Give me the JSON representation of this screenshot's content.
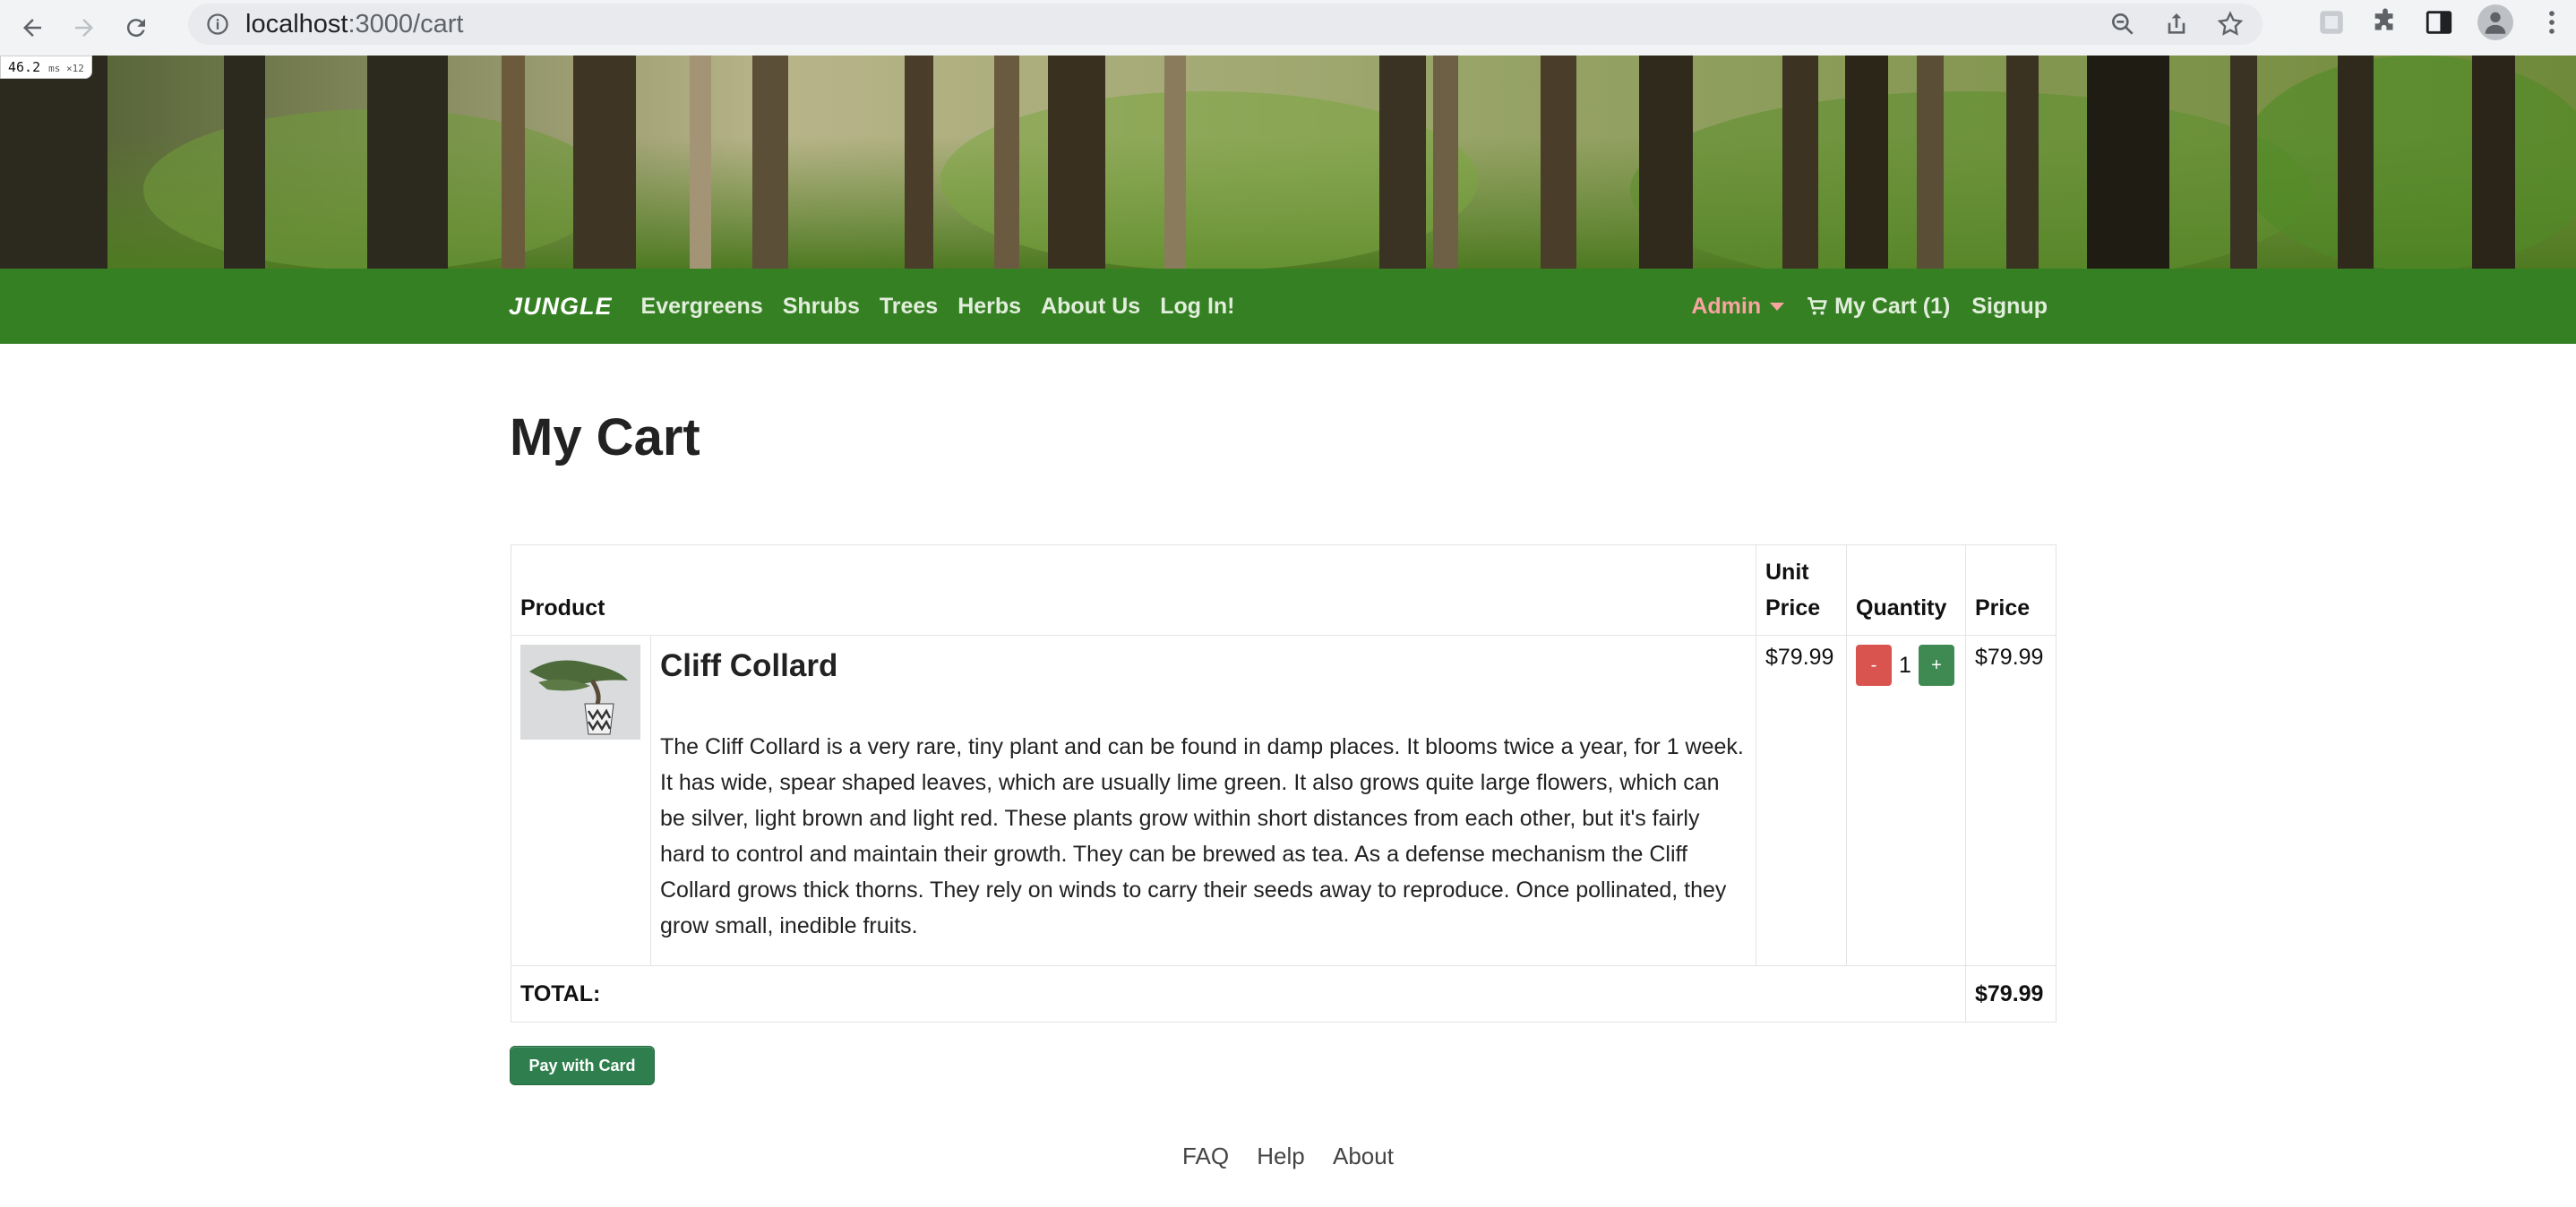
{
  "browser": {
    "url_host": "localhost",
    "url_path": ":3000/cart",
    "perf_value": "46.2",
    "perf_unit": "ms ×12"
  },
  "navbar": {
    "brand": "JUNGLE",
    "links": [
      "Evergreens",
      "Shrubs",
      "Trees",
      "Herbs",
      "About Us",
      "Log In!"
    ],
    "admin": "Admin",
    "cart": "My Cart (1)",
    "signup": "Signup"
  },
  "page": {
    "title": "My Cart"
  },
  "table": {
    "headers": {
      "product": "Product",
      "unit_price": "Unit Price",
      "quantity": "Quantity",
      "price": "Price"
    },
    "items": [
      {
        "name": "Cliff Collard",
        "description": "The Cliff Collard is a very rare, tiny plant and can be found in damp places. It blooms twice a year, for 1 week. It has wide, spear shaped leaves, which are usually lime green. It also grows quite large flowers, which can be silver, light brown and light red. These plants grow within short distances from each other, but it's fairly hard to control and maintain their growth. They can be brewed as tea. As a defense mechanism the Cliff Collard grows thick thorns. They rely on winds to carry their seeds away to reproduce. Once pollinated, they grow small, inedible fruits.",
        "unit_price": "$79.99",
        "quantity": "1",
        "price": "$79.99",
        "minus_label": "-",
        "plus_label": "+"
      }
    ],
    "total_label": "TOTAL:",
    "total_value": "$79.99"
  },
  "pay_button": "Pay with Card",
  "footer": {
    "links": [
      "FAQ",
      "Help",
      "About"
    ]
  },
  "colors": {
    "navbar": "#368024",
    "admin": "#f8a4a0",
    "minus_button": "#d9534f",
    "plus_button": "#3f8a52",
    "pay_button": "#2f7f4e"
  }
}
